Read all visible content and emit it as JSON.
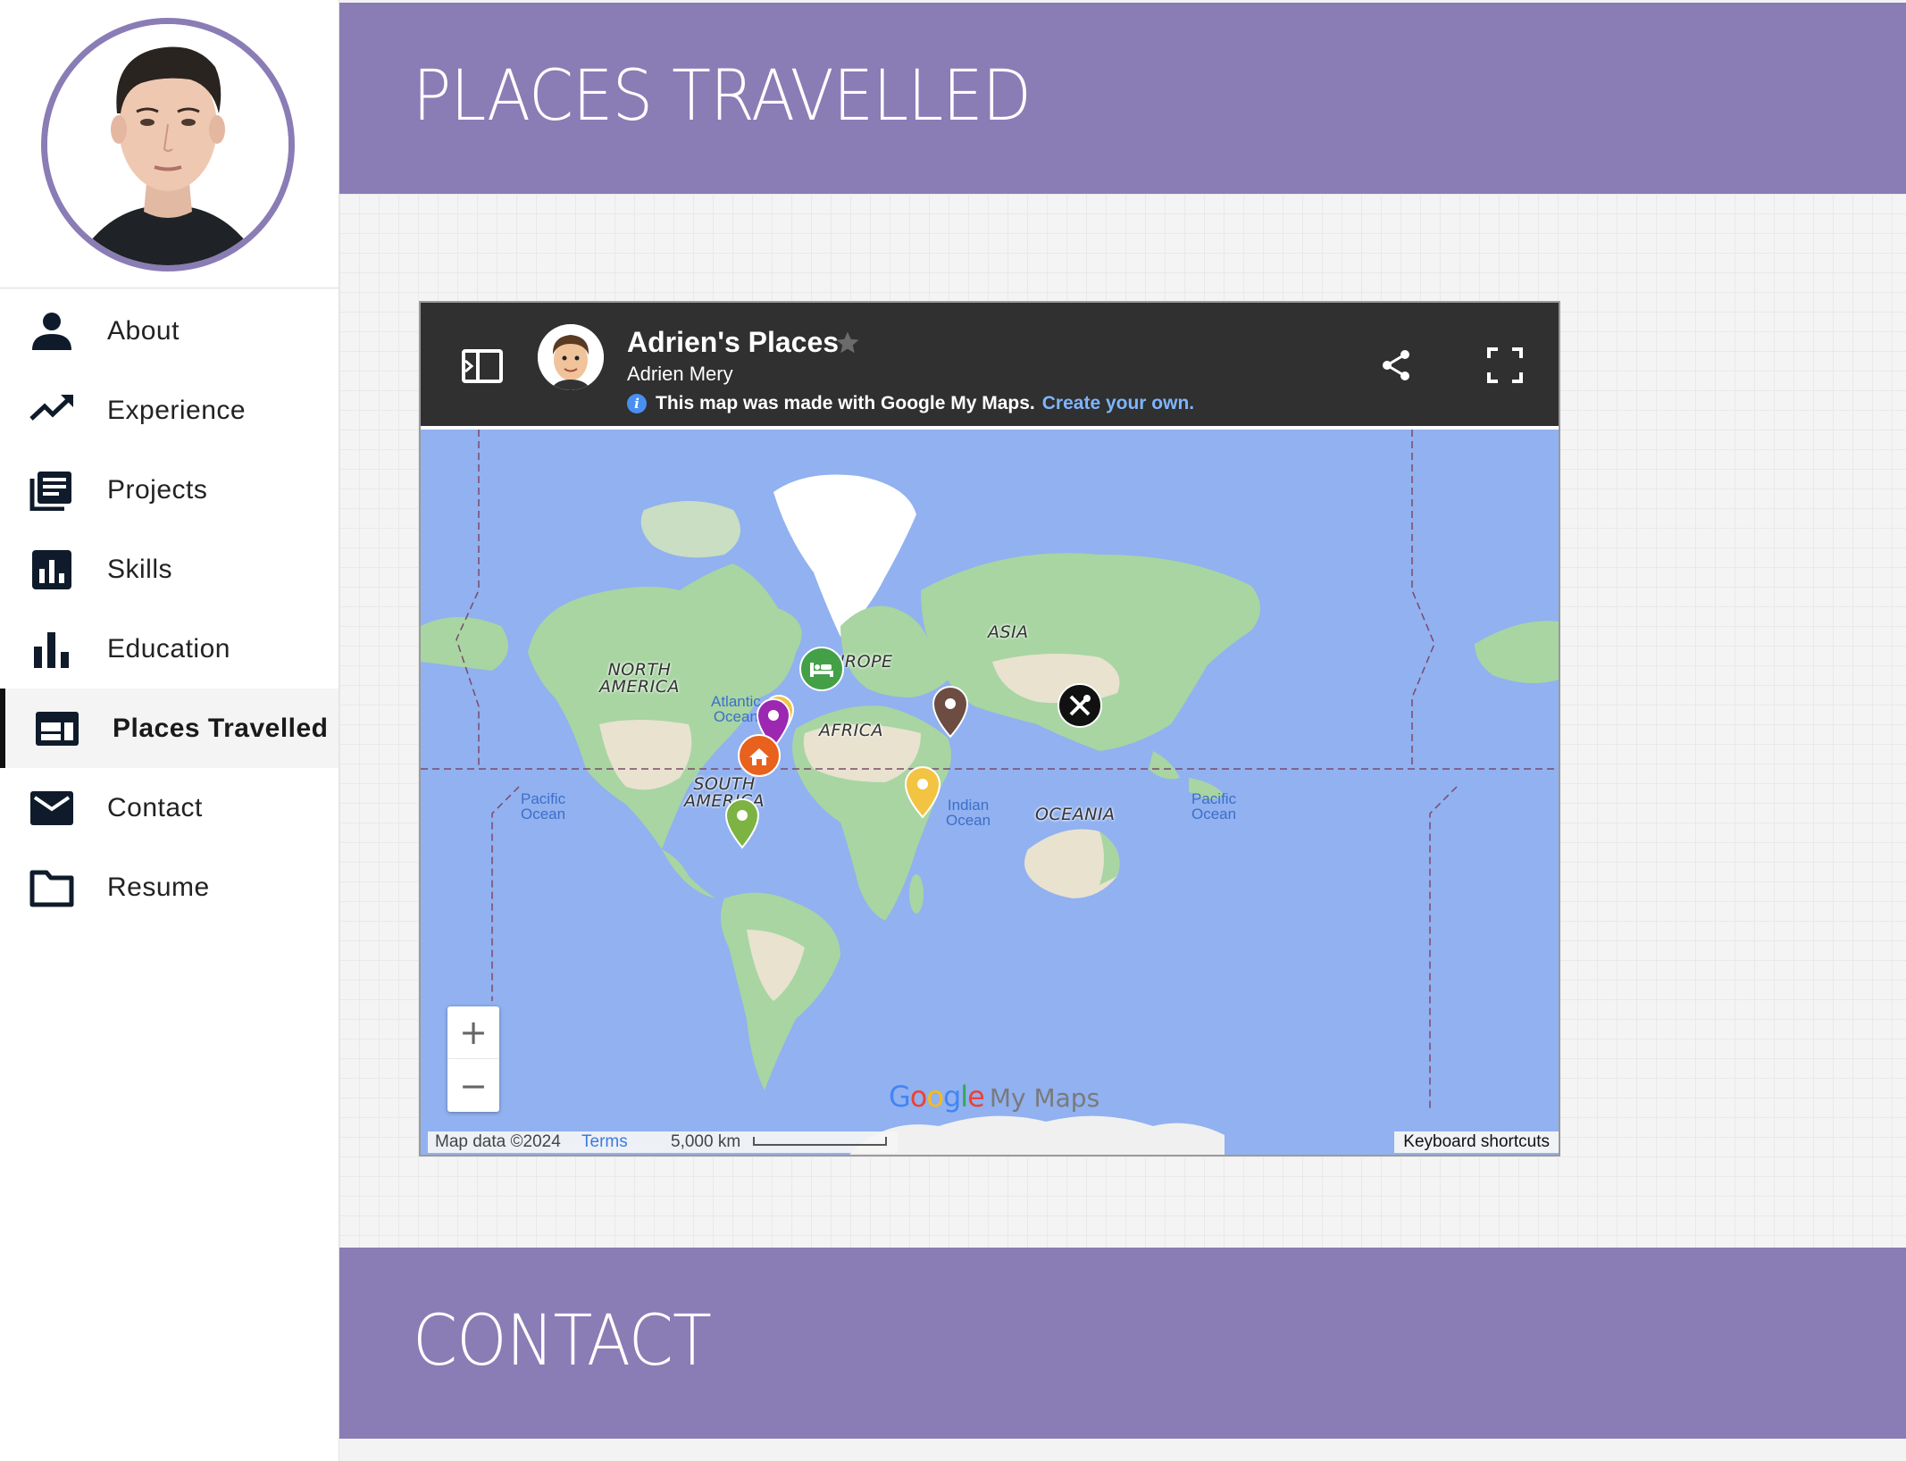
{
  "sidebar": {
    "items": [
      {
        "label": "About",
        "icon": "person-icon"
      },
      {
        "label": "Experience",
        "icon": "trending-up-icon"
      },
      {
        "label": "Projects",
        "icon": "newspaper-icon"
      },
      {
        "label": "Skills",
        "icon": "bar-chart-box-icon"
      },
      {
        "label": "Education",
        "icon": "bar-chart-icon"
      },
      {
        "label": "Places Travelled",
        "icon": "web-layout-icon",
        "active": true
      },
      {
        "label": "Contact",
        "icon": "mail-icon"
      },
      {
        "label": "Resume",
        "icon": "folder-icon"
      }
    ]
  },
  "sections": {
    "places_title": "PLACES TRAVELLED",
    "contact_title": "CONTACT"
  },
  "map": {
    "title": "Adrien's Places",
    "owner": "Adrien Mery",
    "info_text": "This map was made with Google My Maps.",
    "create_link": "Create your own.",
    "labels": {
      "north_america_1": "NORTH",
      "north_america_2": "AMERICA",
      "south_america_1": "SOUTH",
      "south_america_2": "AMERICA",
      "europe": "EUROPE",
      "asia": "ASIA",
      "africa": "AFRICA",
      "oceania": "OCEANIA"
    },
    "oceans": {
      "atlantic_1": "Atlantic",
      "atlantic_2": "Ocean",
      "pacific_left_1": "Pacific",
      "pacific_left_2": "Ocean",
      "pacific_right_1": "Pacific",
      "pacific_right_2": "Ocean",
      "indian_1": "Indian",
      "indian_2": "Ocean"
    },
    "zoom_in": "+",
    "zoom_out": "−",
    "logo_mymaps": "My Maps",
    "map_data": "Map data ©2024",
    "terms": "Terms",
    "scale": "5,000 km",
    "keyboard_shortcuts": "Keyboard shortcuts"
  },
  "colors": {
    "accent": "#8a7cb5",
    "ocean": "#91b1f0",
    "land": "#a8d5a2",
    "topbar": "#2f302f"
  }
}
